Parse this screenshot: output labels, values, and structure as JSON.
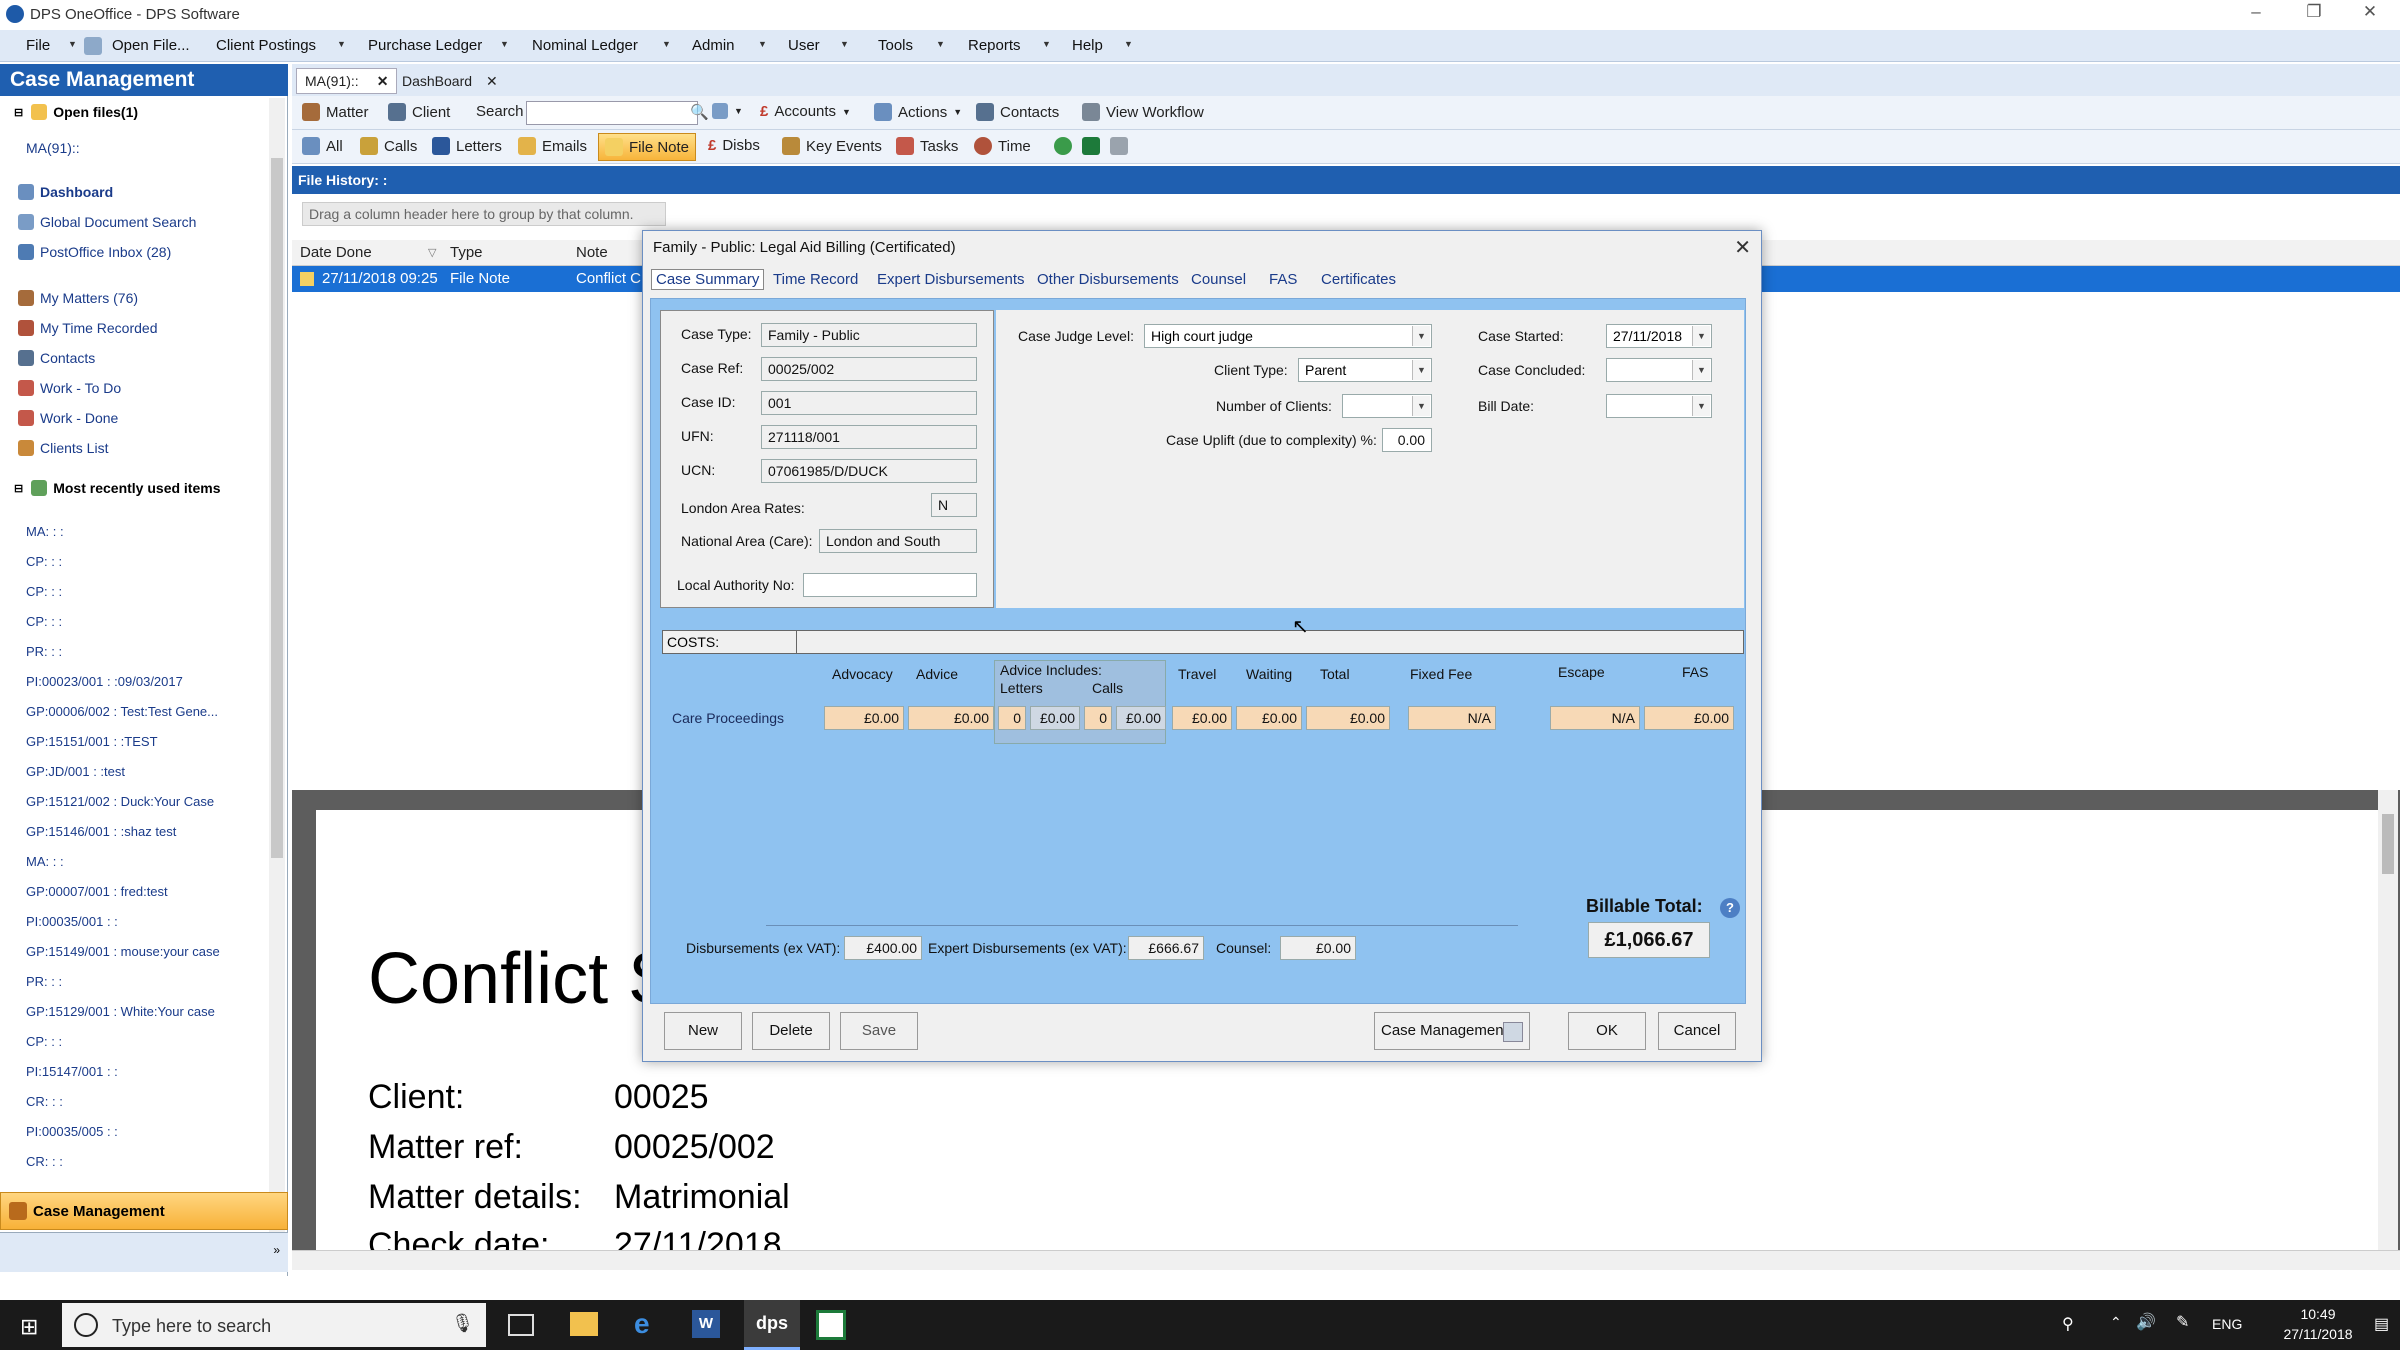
{
  "window": {
    "title": "DPS OneOffice - DPS Software"
  },
  "menu": [
    "File",
    "Open File...",
    "Client Postings",
    "Purchase Ledger",
    "Nominal Ledger",
    "Admin",
    "User",
    "Tools",
    "Reports",
    "Help"
  ],
  "left": {
    "header": "Case Management",
    "open_files": "Open files(1)",
    "open_item": "MA(91)::",
    "nav": [
      "Dashboard",
      "Global Document Search",
      "PostOffice Inbox (28)",
      "My Matters (76)",
      "My Time Recorded",
      "Contacts",
      "Work - To Do",
      "Work - Done",
      "Clients List"
    ],
    "mru_header": "Most recently used items",
    "mru": [
      "MA: : :",
      "CP: : :",
      "CP: : :",
      "CP: : :",
      "PR: : :",
      "PI:00023/001 : :09/03/2017",
      "GP:00006/002 : Test:Test Gene...",
      "GP:15151/001 : :TEST",
      "GP:JD/001 : :test",
      "GP:15121/002 : Duck:Your Case",
      "GP:15146/001 : :shaz test",
      "MA: : :",
      "GP:00007/001 : fred:test",
      "PI:00035/001 : :",
      "GP:15149/001 : mouse:your case",
      "PR: : :",
      "GP:15129/001 : White:Your case",
      "CP: : :",
      "PI:15147/001 : :",
      "CR: : :",
      "PI:00035/005 : :",
      "CR: : :"
    ],
    "bottom_active": "Case Management"
  },
  "tabs": [
    "MA(91)::",
    "DashBoard"
  ],
  "toolbar1": {
    "matter": "Matter",
    "client": "Client",
    "search": "Search",
    "accounts": "Accounts",
    "actions": "Actions",
    "contacts": "Contacts",
    "view_workflow": "View Workflow"
  },
  "toolbar2": [
    "All",
    "Calls",
    "Letters",
    "Emails",
    "File Note",
    "Disbs",
    "Key Events",
    "Tasks",
    "Time"
  ],
  "file_history": {
    "title": "File History: :",
    "group_hint": "Drag a column header here to group by that column.",
    "columns": [
      "Date Done",
      "Type",
      "Note"
    ],
    "row": {
      "date": "27/11/2018 09:25",
      "type": "File Note",
      "note": "Conflict Ch"
    }
  },
  "preview": {
    "heading": "Conflict S",
    "rows": [
      {
        "label": "Client:",
        "value": "00025"
      },
      {
        "label": "Matter ref:",
        "value": "00025/002"
      },
      {
        "label": "Matter details:",
        "value": "Matrimonial"
      },
      {
        "label": "Check date:",
        "value": "27/11/2018"
      }
    ]
  },
  "dialog": {
    "title": "Family - Public:  Legal Aid Billing (Certificated)",
    "tabs": [
      "Case Summary",
      "Time Record",
      "Expert Disbursements",
      "Other Disbursements",
      "Counsel",
      "FAS",
      "Certificates"
    ],
    "case_type_label": "Case Type:",
    "case_type": "Family - Public",
    "case_ref_label": "Case Ref:",
    "case_ref": "00025/002",
    "case_id_label": "Case ID:",
    "case_id": "001",
    "ufn_label": "UFN:",
    "ufn": "271118/001",
    "ucn_label": "UCN:",
    "ucn": "07061985/D/DUCK",
    "london_label": "London Area Rates:",
    "london": "N",
    "national_label": "National Area (Care):",
    "national": "London and South",
    "local_auth_label": "Local Authority No:",
    "local_auth": "",
    "judge_label": "Case Judge Level:",
    "judge": "High court judge",
    "client_type_label": "Client Type:",
    "client_type": "Parent",
    "num_clients_label": "Number of Clients:",
    "num_clients": "",
    "uplift_label": "Case Uplift (due to complexity) %:",
    "uplift": "0.00",
    "started_label": "Case Started:",
    "started": "27/11/2018",
    "concluded_label": "Case Concluded:",
    "concluded": "",
    "bill_label": "Bill Date:",
    "bill": "",
    "costs_label": "COSTS:",
    "cost_headers": {
      "advocacy": "Advocacy",
      "advice": "Advice",
      "adv_includes": "Advice Includes:",
      "letters": "Letters",
      "calls": "Calls",
      "travel": "Travel",
      "waiting": "Waiting",
      "total": "Total",
      "fixed_fee": "Fixed Fee",
      "escape": "Escape",
      "fas": "FAS"
    },
    "care_label": "Care Proceedings",
    "care": {
      "advocacy": "£0.00",
      "advice": "£0.00",
      "letters_n": "0",
      "letters": "£0.00",
      "calls_n": "0",
      "calls": "£0.00",
      "travel": "£0.00",
      "waiting": "£0.00",
      "total": "£0.00",
      "fixed_fee": "N/A",
      "escape": "N/A",
      "fas": "£0.00"
    },
    "billable_label": "Billable Total:",
    "billable": "£1,066.67",
    "disb_label": "Disbursements (ex VAT):",
    "disb": "£400.00",
    "expert_label": "Expert Disbursements (ex VAT):",
    "expert": "£666.67",
    "counsel_label": "Counsel:",
    "counsel": "£0.00",
    "buttons": {
      "new": "New",
      "delete": "Delete",
      "save": "Save",
      "case_mgmt": "Case Management",
      "ok": "OK",
      "cancel": "Cancel"
    }
  },
  "taskbar": {
    "search": "Type here to search",
    "lang": "ENG",
    "time": "10:49",
    "date": "27/11/2018"
  }
}
